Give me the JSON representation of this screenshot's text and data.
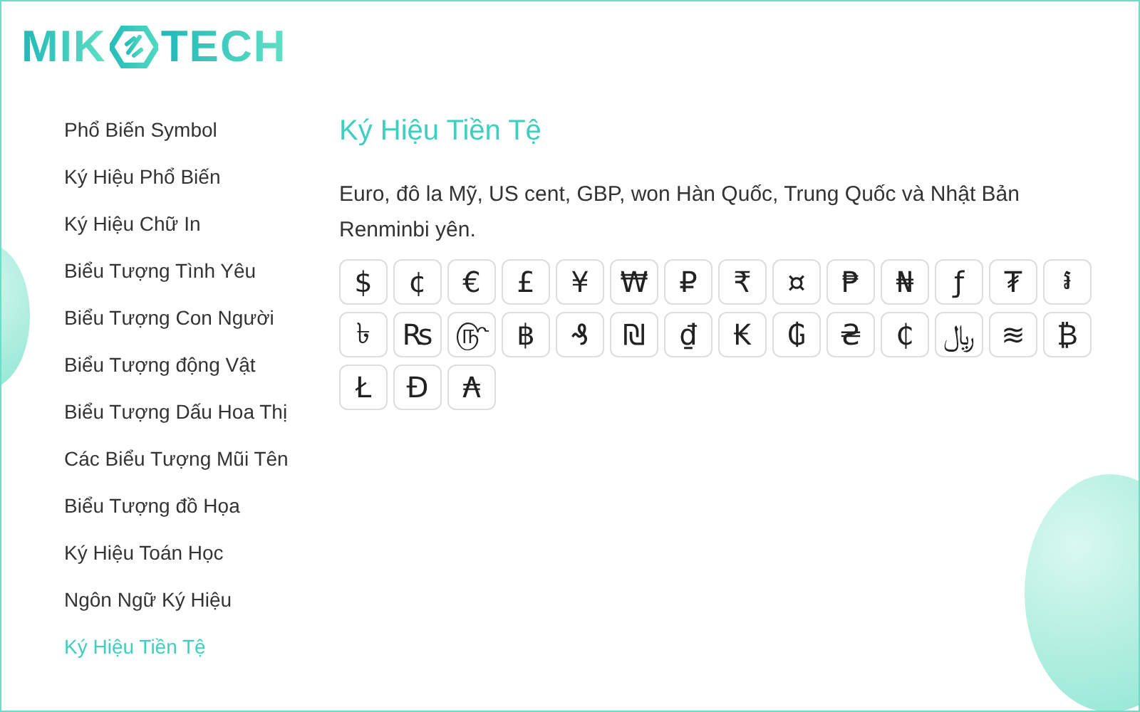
{
  "logo": {
    "left": "MIK",
    "right": "TECH"
  },
  "sidebar": {
    "items": [
      {
        "label": "Phổ Biến Symbol",
        "selected": false
      },
      {
        "label": "Ký Hiệu Phổ Biến",
        "selected": false
      },
      {
        "label": "Ký Hiệu Chữ In",
        "selected": false
      },
      {
        "label": "Biểu Tượng Tình Yêu",
        "selected": false
      },
      {
        "label": "Biểu Tượng Con Người",
        "selected": false
      },
      {
        "label": "Biểu Tượng động Vật",
        "selected": false
      },
      {
        "label": "Biểu Tượng Dấu Hoa Thị",
        "selected": false
      },
      {
        "label": "Các Biểu Tượng Mũi Tên",
        "selected": false
      },
      {
        "label": "Biểu Tượng đồ Họa",
        "selected": false
      },
      {
        "label": "Ký Hiệu Toán Học",
        "selected": false
      },
      {
        "label": "Ngôn Ngữ Ký Hiệu",
        "selected": false
      },
      {
        "label": "Ký Hiệu Tiền Tệ",
        "selected": true
      }
    ]
  },
  "content": {
    "title": "Ký Hiệu Tiền Tệ",
    "description": "Euro, đô la Mỹ, US cent, GBP, won Hàn Quốc, Trung Quốc và Nhật Bản Renminbi yên.",
    "symbols": [
      "$",
      "¢",
      "€",
      "£",
      "¥",
      "₩",
      "₽",
      "₹",
      "¤",
      "₱",
      "₦",
      "ƒ",
      "₮",
      "៛",
      "৳",
      "₨",
      "௹",
      "฿",
      "₰",
      "₪",
      "₫",
      "₭",
      "₲",
      "₴",
      "₵",
      "﷼",
      "≋",
      "₿",
      "Ł",
      "Đ",
      "₳"
    ]
  }
}
